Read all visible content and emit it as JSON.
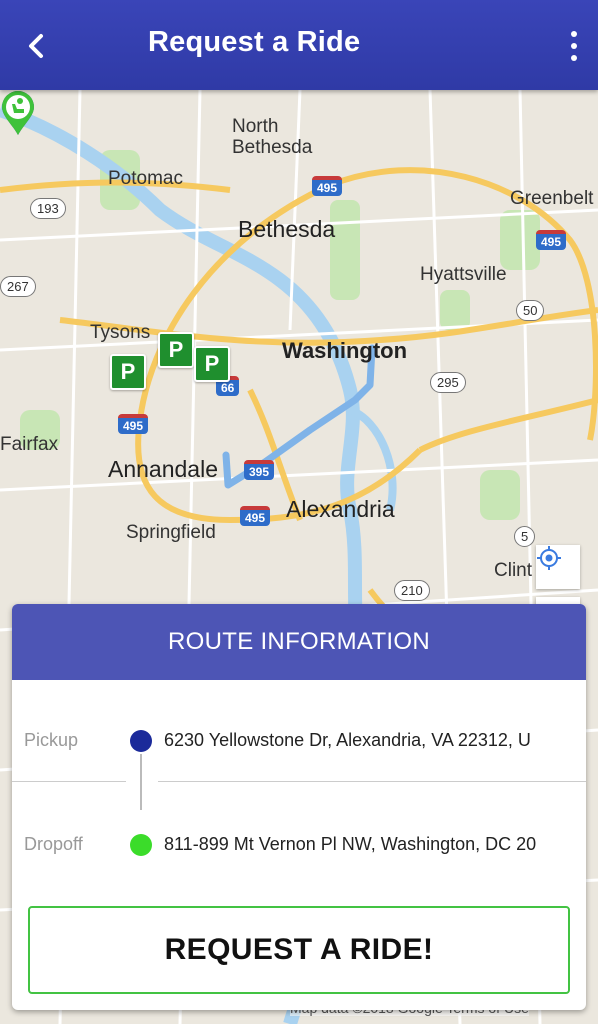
{
  "header": {
    "title": "Request a Ride",
    "back_icon": "chevron-left-icon",
    "menu_icon": "more-vert-icon"
  },
  "map": {
    "places": {
      "north_bethesda": "North\nBethesda",
      "potomac": "Potomac",
      "bethesda": "Bethesda",
      "greenbelt": "Greenbelt",
      "hyattsville": "Hyattsville",
      "tysons": "Tysons",
      "washington": "Washington",
      "fairfax": "Fairfax",
      "annandale": "Annandale",
      "alexandria": "Alexandria",
      "springfield": "Springfield",
      "clinton": "Clint"
    },
    "highways": [
      "495",
      "495",
      "495",
      "495",
      "395",
      "66"
    ],
    "routes": [
      "193",
      "267",
      "50",
      "295",
      "210",
      "5"
    ],
    "parking_label": "P",
    "controls": {
      "locate_icon": "crosshair-icon",
      "zoom_in": "+",
      "zoom_out": "−"
    },
    "attribution": "Map data ©2018 Google   Terms of Use"
  },
  "route_info": {
    "heading": "ROUTE INFORMATION",
    "pickup_label": "Pickup",
    "pickup_address": "6230 Yellowstone Dr, Alexandria, VA 22312, U",
    "dropoff_label": "Dropoff",
    "dropoff_address": "811-899 Mt Vernon Pl NW, Washington, DC 20",
    "pickup_color": "#1b2a9a",
    "dropoff_color": "#3bdc2a"
  },
  "actions": {
    "request_label": "REQUEST A RIDE!"
  }
}
